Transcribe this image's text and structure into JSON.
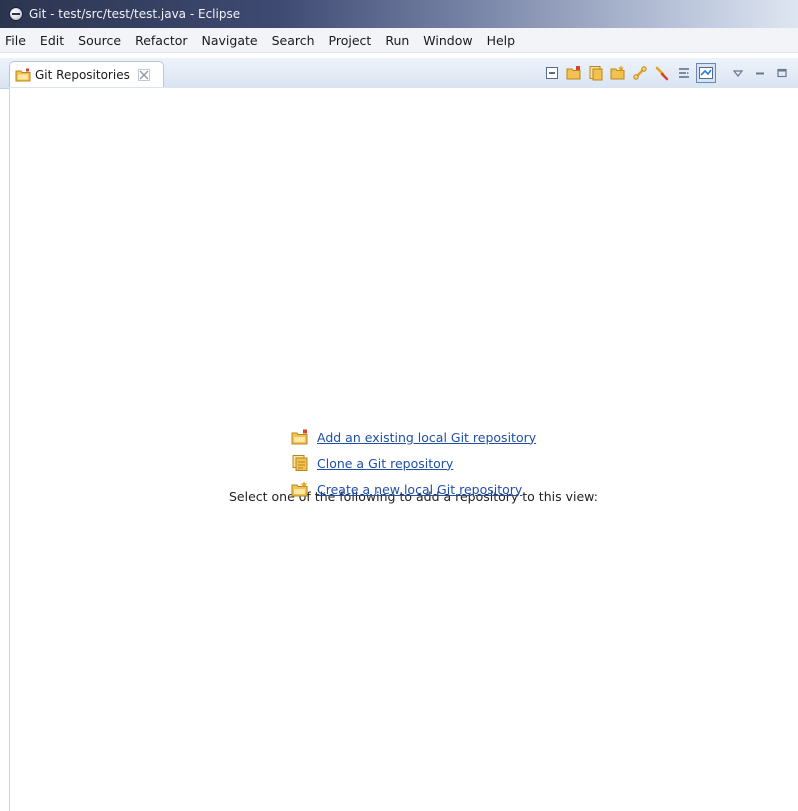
{
  "window": {
    "title": "Git - test/src/test/test.java - Eclipse"
  },
  "menubar": {
    "items": [
      "File",
      "Edit",
      "Source",
      "Refactor",
      "Navigate",
      "Search",
      "Project",
      "Run",
      "Window",
      "Help"
    ]
  },
  "view": {
    "tab": {
      "label": "Git Repositories",
      "icon": "git-repositories-icon",
      "close_icon": "close-icon"
    },
    "toolbar": {
      "buttons": [
        "collapse-all-icon",
        "add-repository-icon",
        "clone-repository-icon",
        "create-repository-icon",
        "link-with-editor-icon",
        "refresh-icon",
        "layout-icon",
        "link-with-selection-icon"
      ],
      "active_button": "link-with-selection-icon",
      "view_menu_icon": "view-menu-icon",
      "minimize_icon": "minimize-icon",
      "maximize_icon": "maximize-icon"
    }
  },
  "empty_state": {
    "prompt": "Select one of the following to add a repository to this view:",
    "links": [
      {
        "label": "Add an existing local Git repository",
        "icon": "add-repository-icon"
      },
      {
        "label": "Clone a Git repository",
        "icon": "clone-repository-icon"
      },
      {
        "label": "Create a new local Git repository",
        "icon": "create-repository-icon"
      }
    ]
  },
  "colors": {
    "link": "#1f4fa8",
    "title_bar": "#2c3550",
    "view_bar": "#d9e4f2",
    "accent_orange": "#e8a21a"
  }
}
